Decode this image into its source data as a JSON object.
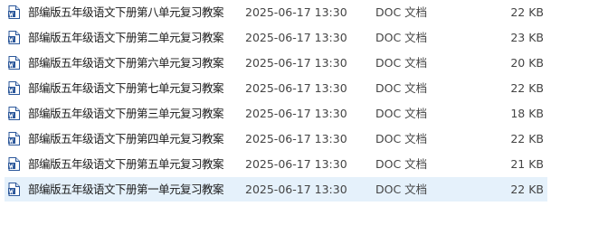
{
  "files": [
    {
      "name": "部编版五年级语文下册第八单元复习教案",
      "modified": "2025-06-17 13:30",
      "type": "DOC 文档",
      "size": "22 KB",
      "icon": "word-doc-icon",
      "selected": false
    },
    {
      "name": "部编版五年级语文下册第二单元复习教案",
      "modified": "2025-06-17 13:30",
      "type": "DOC 文档",
      "size": "23 KB",
      "icon": "word-doc-icon",
      "selected": false
    },
    {
      "name": "部编版五年级语文下册第六单元复习教案",
      "modified": "2025-06-17 13:30",
      "type": "DOC 文档",
      "size": "20 KB",
      "icon": "word-doc-icon",
      "selected": false
    },
    {
      "name": "部编版五年级语文下册第七单元复习教案",
      "modified": "2025-06-17 13:30",
      "type": "DOC 文档",
      "size": "22 KB",
      "icon": "word-doc-icon",
      "selected": false
    },
    {
      "name": "部编版五年级语文下册第三单元复习教案",
      "modified": "2025-06-17 13:30",
      "type": "DOC 文档",
      "size": "18 KB",
      "icon": "word-doc-icon",
      "selected": false
    },
    {
      "name": "部编版五年级语文下册第四单元复习教案",
      "modified": "2025-06-17 13:30",
      "type": "DOC 文档",
      "size": "22 KB",
      "icon": "word-doc-icon",
      "selected": false
    },
    {
      "name": "部编版五年级语文下册第五单元复习教案",
      "modified": "2025-06-17 13:30",
      "type": "DOC 文档",
      "size": "21 KB",
      "icon": "word-doc-icon",
      "selected": false
    },
    {
      "name": "部编版五年级语文下册第一单元复习教案",
      "modified": "2025-06-17 13:30",
      "type": "DOC 文档",
      "size": "22 KB",
      "icon": "word-doc-icon",
      "selected": true
    }
  ],
  "colors": {
    "selection_background": "#e5f1fb",
    "icon_blue": "#2b579a"
  }
}
